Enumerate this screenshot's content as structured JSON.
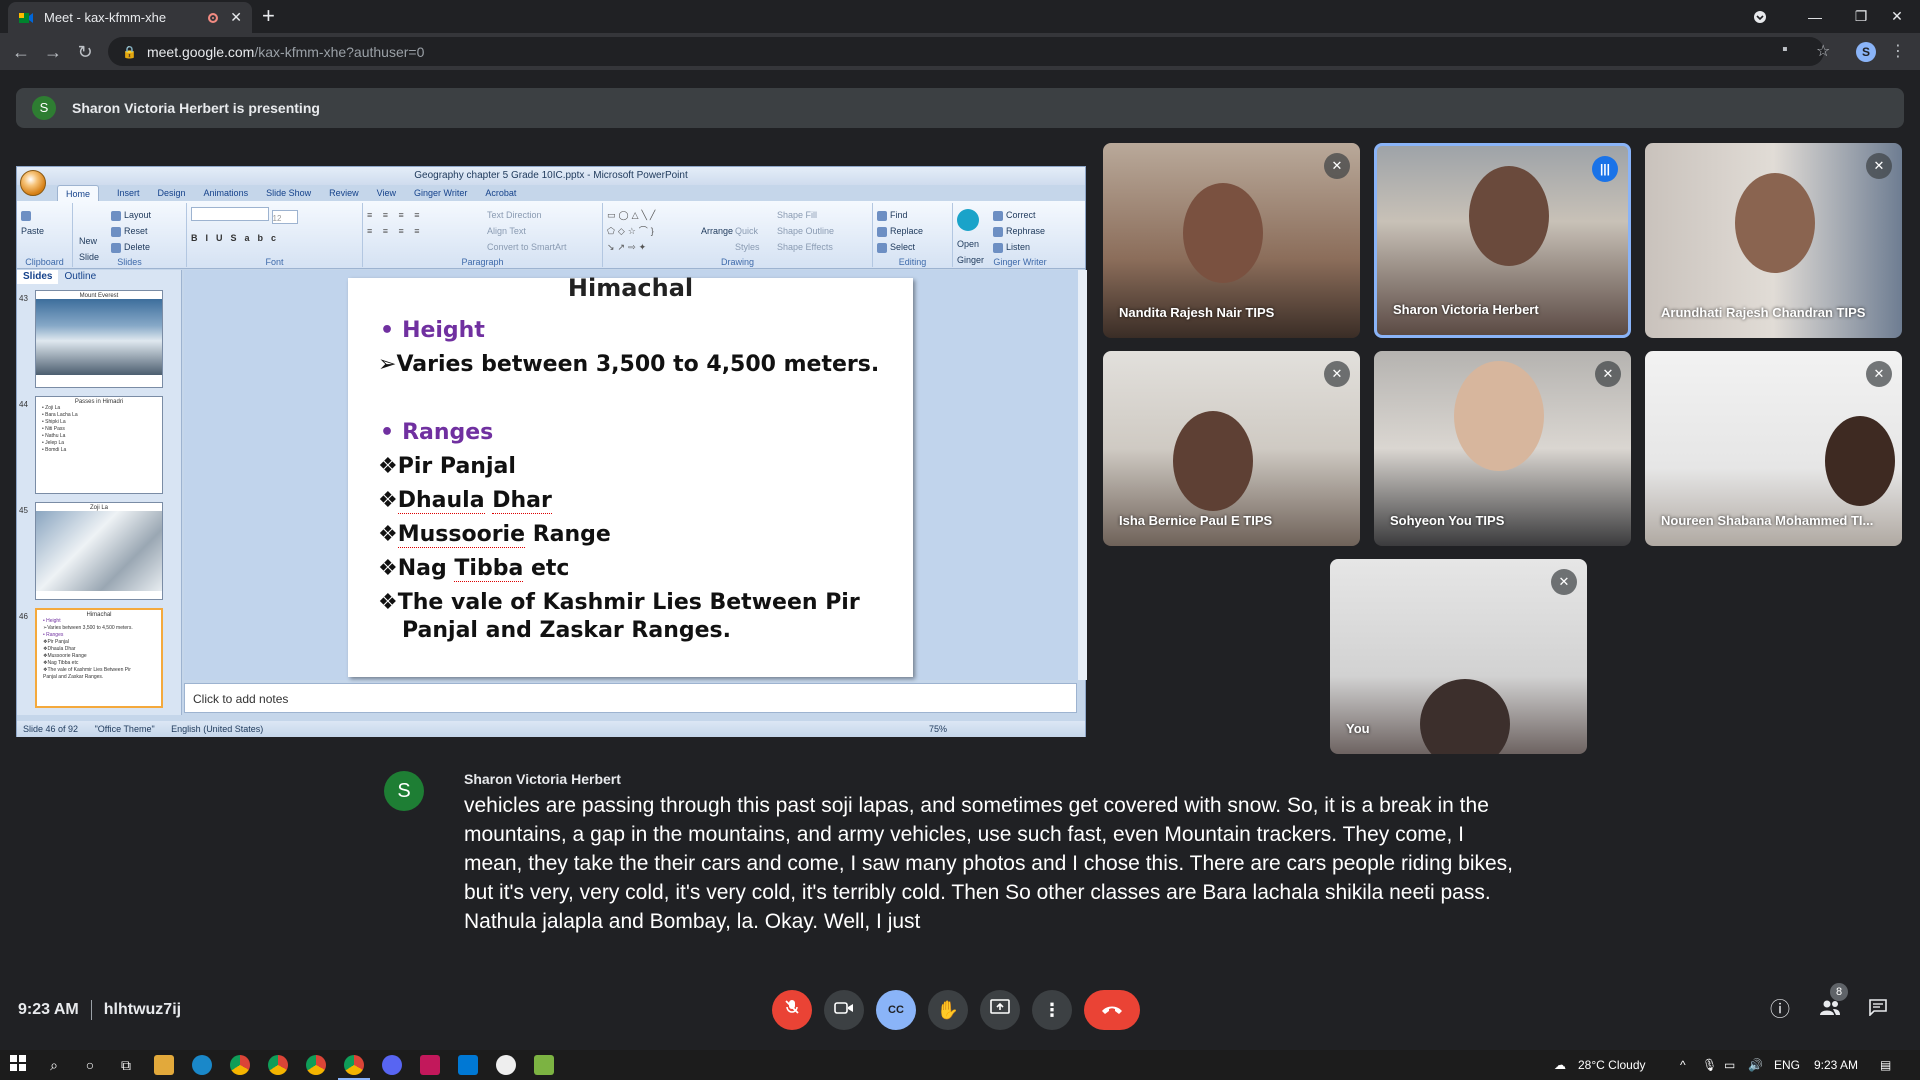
{
  "browser": {
    "tab_title": "Meet - kax-kfmm-xhe",
    "tab_close": "✕",
    "new_tab": "+",
    "url_host": "meet.google.com",
    "url_path": "/kax-kfmm-xhe?authuser=0",
    "profile_initial": "S",
    "window_controls": {
      "minimize": "—",
      "restore": "❐",
      "close": "✕"
    },
    "nav": {
      "back": "←",
      "forward": "→",
      "reload": "↻"
    }
  },
  "banner": {
    "avatar": "S",
    "text": "Sharon Victoria Herbert is presenting"
  },
  "ppt": {
    "window_title": "Geography chapter 5 Grade 10IC.pptx - Microsoft PowerPoint",
    "tabs": [
      "Home",
      "Insert",
      "Design",
      "Animations",
      "Slide Show",
      "Review",
      "View",
      "Ginger Writer",
      "Acrobat"
    ],
    "groups": {
      "clipboard": {
        "label": "Clipboard",
        "items": [
          "Paste"
        ]
      },
      "slides": {
        "label": "Slides",
        "items": [
          "Layout",
          "Reset",
          "Delete"
        ],
        "new": "New Slide"
      },
      "font": {
        "label": "Font",
        "size": "12"
      },
      "paragraph": {
        "label": "Paragraph",
        "items": [
          "Text Direction",
          "Align Text",
          "Convert to SmartArt"
        ]
      },
      "drawing": {
        "label": "Drawing",
        "items": [
          "Shape Fill",
          "Shape Outline",
          "Shape Effects"
        ],
        "arrange": "Arrange",
        "quick": "Quick Styles"
      },
      "editing": {
        "label": "Editing",
        "items": [
          "Find",
          "Replace",
          "Select"
        ]
      },
      "ginger": {
        "label": "Ginger Writer",
        "open": "Open Ginger",
        "items": [
          "Correct",
          "Rephrase",
          "Listen"
        ]
      }
    },
    "side_tabs": [
      "Slides",
      "Outline"
    ],
    "thumbs": [
      {
        "num": "43",
        "title": "Mount Everest"
      },
      {
        "num": "44",
        "title": "Passes in Himadri",
        "lines": [
          "• Zoji La",
          "• Bara Lacha La",
          "• Shipki La",
          "• Niti Pass",
          "• Nathu La",
          "• Jelep La",
          "• Bomdi La"
        ]
      },
      {
        "num": "45",
        "title": "Zoji La"
      },
      {
        "num": "46",
        "title": "Himachal",
        "lines": [
          "• Height",
          "➢Varies between 3,500 to 4,500 meters.",
          "",
          "• Ranges",
          "❖Pir Panjal",
          "❖Dhaula Dhar",
          "❖Mussoorie Range",
          "❖Nag Tibba etc",
          "❖The vale of Kashmir  Lies Between Pir",
          "  Panjal and Zaskar Ranges."
        ]
      }
    ],
    "slide": {
      "title": "Himachal",
      "height_bullet": "•",
      "height": "Height",
      "arrow": "➢",
      "height_text": "Varies between 3,500 to 4,500 meters.",
      "ranges_bullet": "•",
      "ranges": "Ranges",
      "diamond": "❖",
      "r1": "Pir Panjal",
      "r2a": "Dhaula",
      "r2b": "Dhar",
      "r3a": "Mussoorie",
      "r3b": "Range",
      "r4a": "Nag",
      "r4b": "Tibba",
      "r4c": "etc",
      "r5": "The vale of Kashmir  Lies Between Pir",
      "r5b": "Panjal and Zaskar Ranges."
    },
    "notes": "Click to add notes",
    "status": {
      "slide": "Slide 46 of 92",
      "theme": "\"Office Theme\"",
      "lang": "English (United States)",
      "zoom": "75%"
    }
  },
  "participants": [
    {
      "name": "Nandita Rajesh Nair TIPS",
      "muted": true
    },
    {
      "name": "Sharon Victoria Herbert",
      "muted": false
    },
    {
      "name": "Arundhati Rajesh Chandran TIPS",
      "muted": true
    },
    {
      "name": "Isha Bernice Paul E TIPS",
      "muted": true
    },
    {
      "name": "Sohyeon You TIPS",
      "muted": true
    },
    {
      "name": "Noureen Shabana Mohammed TI...",
      "muted": true
    },
    {
      "name": "You",
      "muted": true
    }
  ],
  "caption": {
    "avatar": "S",
    "speaker": "Sharon Victoria Herbert",
    "text": "vehicles are passing through this past soji lapas, and sometimes get covered with snow. So, it is a break in the mountains, a gap in the mountains, and army vehicles, use such fast, even Mountain trackers. They come, I mean, they take the their cars and come, I saw many photos and I chose this. There are cars people riding bikes, but it's very, very cold, it's very cold, it's terribly cold. Then So other classes are Bara lachala shikila neeti pass. Nathula jalapla and Bombay, la. Okay. Well, I just"
  },
  "meeting": {
    "time": "9:23 AM",
    "code": "hlhtwuz7ij",
    "people_count": "8"
  },
  "icons": {
    "mic_off": "🎙",
    "camera": "▭",
    "cc": "CC",
    "hand": "✋",
    "present": "⬆",
    "more": "⋮",
    "end": "☎",
    "info": "ⓘ",
    "people": "👥",
    "chat": "💬"
  },
  "taskbar": {
    "weather": "28°C  Cloudy",
    "lang": "ENG",
    "time": "9:23 AM"
  },
  "colors": {
    "meet_bg": "#202124",
    "accent_blue": "#8ab4f8",
    "end_red": "#ea4335",
    "presenter_green": "#1e7e34",
    "slide_purple": "#7030a0"
  }
}
